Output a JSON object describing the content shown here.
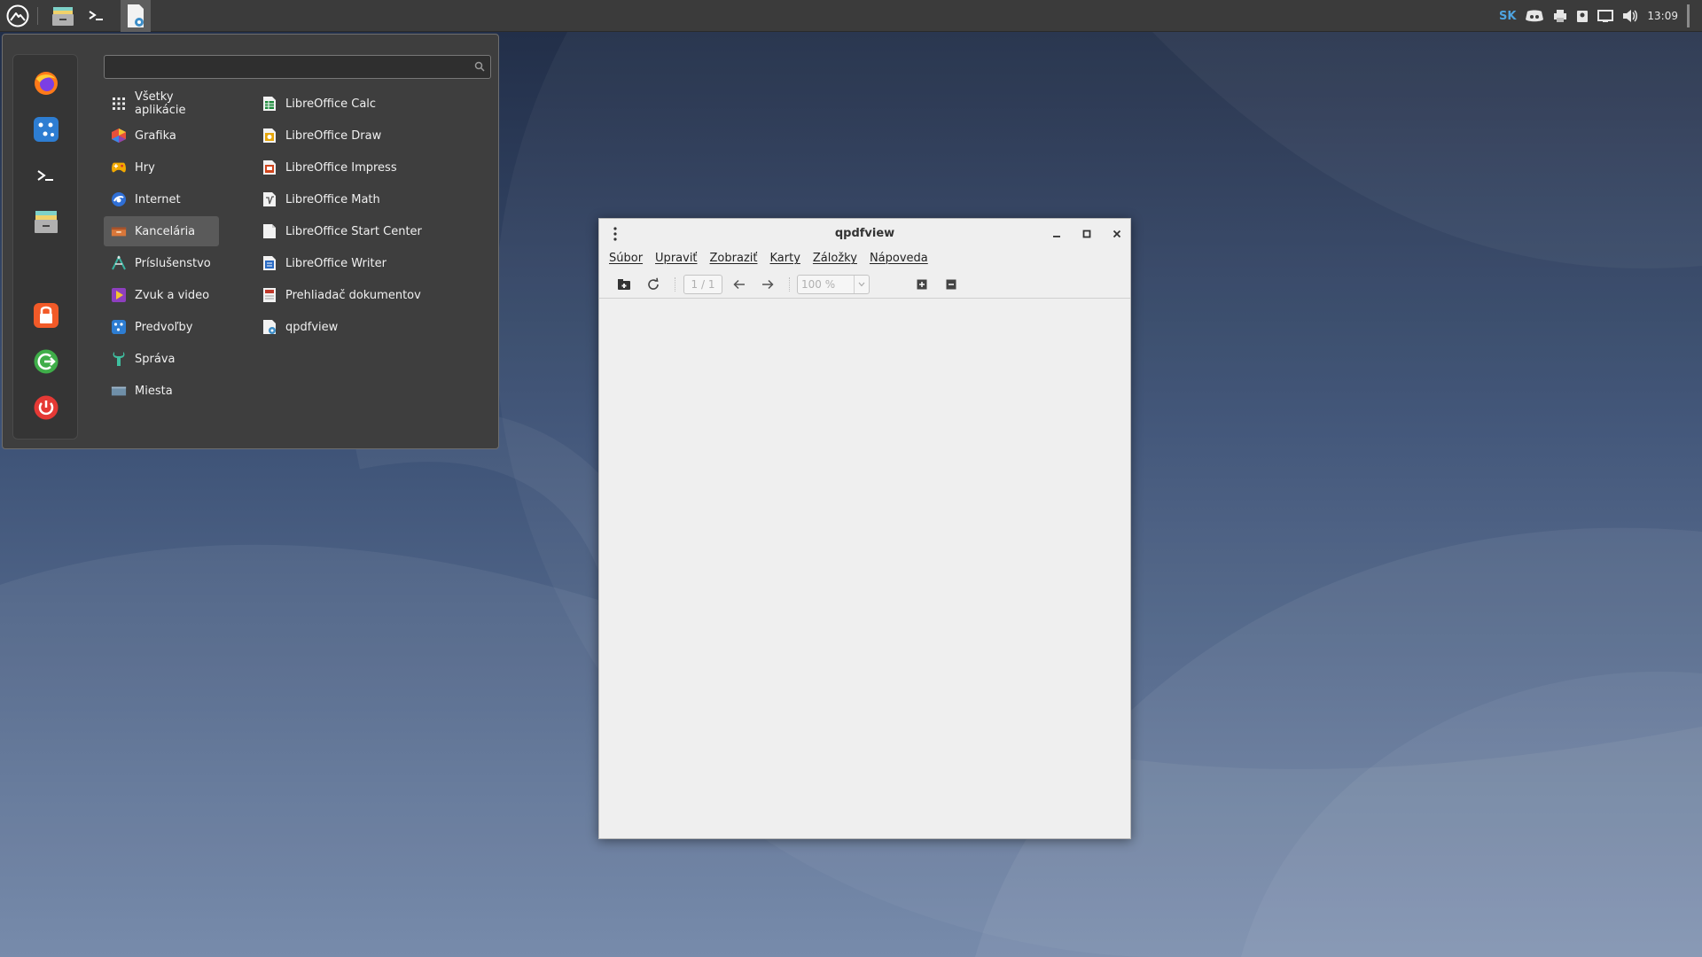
{
  "panel": {
    "keyboard_layout": "SK",
    "clock": "13:09",
    "icons": [
      "start-menu-icon",
      "file-manager-icon",
      "terminal-icon",
      "qpdfview-task-icon"
    ]
  },
  "appmenu": {
    "search": {
      "value": "",
      "placeholder": ""
    },
    "favorites": [
      "firefox-icon",
      "settings-icon",
      "terminal-icon",
      "file-manager-icon",
      "lock-icon",
      "logout-icon",
      "power-icon"
    ],
    "categories": [
      {
        "label": "Všetky aplikácie",
        "icon": "grid-icon"
      },
      {
        "label": "Grafika",
        "icon": "graphics-icon"
      },
      {
        "label": "Hry",
        "icon": "games-icon"
      },
      {
        "label": "Internet",
        "icon": "internet-icon"
      },
      {
        "label": "Kancelária",
        "icon": "office-icon",
        "selected": true
      },
      {
        "label": "Príslušenstvo",
        "icon": "accessories-icon"
      },
      {
        "label": "Zvuk a video",
        "icon": "multimedia-icon"
      },
      {
        "label": "Predvoľby",
        "icon": "preferences-icon"
      },
      {
        "label": "Správa",
        "icon": "administration-icon"
      },
      {
        "label": "Miesta",
        "icon": "places-icon"
      }
    ],
    "apps": [
      {
        "label": "LibreOffice Calc",
        "icon": "libreoffice-calc-icon",
        "color": "#1e8a3c"
      },
      {
        "label": "LibreOffice Draw",
        "icon": "libreoffice-draw-icon",
        "color": "#e5a50a"
      },
      {
        "label": "LibreOffice Impress",
        "icon": "libreoffice-impress-icon",
        "color": "#d0441c"
      },
      {
        "label": "LibreOffice Math",
        "icon": "libreoffice-math-icon",
        "color": "#777777"
      },
      {
        "label": "LibreOffice Start Center",
        "icon": "libreoffice-start-icon",
        "color": "#ffffff"
      },
      {
        "label": "LibreOffice Writer",
        "icon": "libreoffice-writer-icon",
        "color": "#2a6bc4"
      },
      {
        "label": "Prehliadač dokumentov",
        "icon": "document-viewer-icon",
        "color": "#c0392b"
      },
      {
        "label": "qpdfview",
        "icon": "qpdfview-icon",
        "color": "#3c8dc7"
      }
    ]
  },
  "window": {
    "title": "qpdfview",
    "menu": [
      "Súbor",
      "Upraviť",
      "Zobraziť",
      "Karty",
      "Záložky",
      "Nápoveda"
    ],
    "toolbar": {
      "page": "1 / 1",
      "zoom": "100 %"
    }
  }
}
